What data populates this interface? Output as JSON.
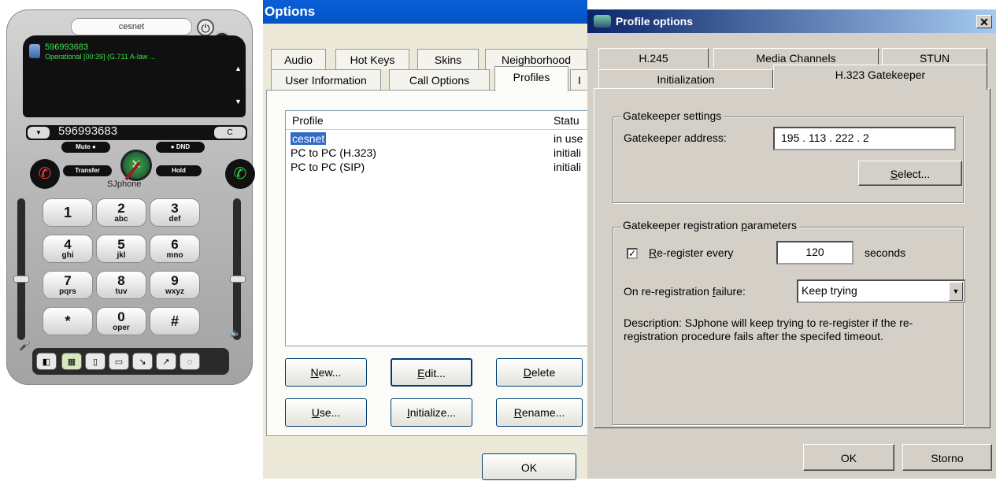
{
  "phone": {
    "title": "cesnet",
    "status_number": "596993683",
    "status_text": "Operational [00:39] (G.711 A-law ...",
    "dial_number": "596993683",
    "brand": "SJphone",
    "buttons": {
      "mute": "Mute",
      "dnd": "DND",
      "transfer": "Transfer",
      "hold": "Hold",
      "clear": "C"
    },
    "keys": [
      {
        "d": "1",
        "l": ""
      },
      {
        "d": "2",
        "l": "abc"
      },
      {
        "d": "3",
        "l": "def"
      },
      {
        "d": "4",
        "l": "ghi"
      },
      {
        "d": "5",
        "l": "jkl"
      },
      {
        "d": "6",
        "l": "mno"
      },
      {
        "d": "7",
        "l": "pqrs"
      },
      {
        "d": "8",
        "l": "tuv"
      },
      {
        "d": "9",
        "l": "wxyz"
      },
      {
        "d": "*",
        "l": ""
      },
      {
        "d": "0",
        "l": "oper"
      },
      {
        "d": "#",
        "l": ""
      }
    ]
  },
  "options": {
    "title": "Options",
    "tabs_row1": [
      "Audio",
      "Hot Keys",
      "Skins",
      "Neighborhood"
    ],
    "tabs_row2": [
      "User Information",
      "Call Options",
      "Profiles",
      "I"
    ],
    "active_tab": "Profiles",
    "columns": [
      "Profile",
      "Statu"
    ],
    "profiles": [
      {
        "name": "cesnet",
        "status": "in use",
        "selected": true
      },
      {
        "name": "PC to PC (H.323)",
        "status": "initiali",
        "selected": false
      },
      {
        "name": "PC to PC (SIP)",
        "status": "initiali",
        "selected": false
      }
    ],
    "buttons": {
      "new_pre": "",
      "new_acc": "N",
      "new_post": "ew...",
      "edit_pre": "",
      "edit_acc": "E",
      "edit_post": "dit...",
      "delete_pre": "",
      "delete_acc": "D",
      "delete_post": "elete",
      "use_pre": "",
      "use_acc": "U",
      "use_post": "se...",
      "init_pre": "",
      "init_acc": "I",
      "init_post": "nitialize...",
      "rename_pre": "",
      "rename_acc": "R",
      "rename_post": "ename...",
      "ok": "OK"
    }
  },
  "profile": {
    "title": "Profile options",
    "tabs_row1": [
      "H.245",
      "Media Channels",
      "STUN"
    ],
    "tabs_row2": [
      "Initialization",
      "H.323 Gatekeeper"
    ],
    "active_tab": "H.323 Gatekeeper",
    "gk_settings": {
      "group_label": "Gatekeeper settings",
      "address_label": "Gatekeeper address:",
      "address_value": "195 . 113 . 222 .  2",
      "select_pre": "",
      "select_acc": "S",
      "select_post": "elect..."
    },
    "gk_reg": {
      "group_label_pre": "Gatekeeper registration ",
      "group_label_acc": "p",
      "group_label_post": "arameters",
      "rereg_checked": true,
      "rereg_pre": "",
      "rereg_acc": "R",
      "rereg_post": "e-register every",
      "rereg_value": "120",
      "seconds": "seconds",
      "failure_pre": "On re-registration ",
      "failure_acc": "f",
      "failure_post": "ailure:",
      "failure_value": "Keep trying",
      "description": "Description: SJphone will keep trying to re-register if the re-registration procedure fails after the specifed timeout."
    },
    "buttons": {
      "ok": "OK",
      "cancel": "Storno"
    }
  }
}
